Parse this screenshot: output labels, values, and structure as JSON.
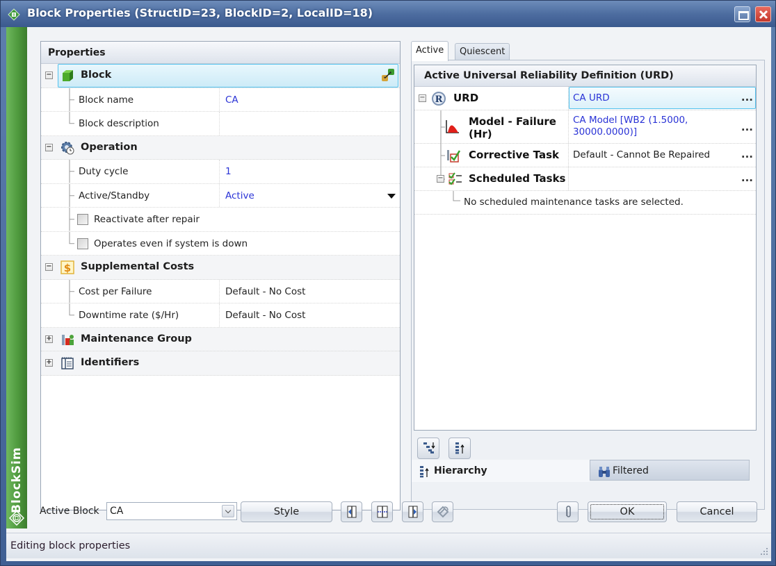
{
  "window": {
    "title": "Block Properties (StructID=23, BlockID=2, LocalID=18)",
    "brand": "BlockSim",
    "controls": [
      "maximize-icon",
      "close-icon"
    ]
  },
  "properties": {
    "header": "Properties",
    "categories": [
      {
        "label": "Block",
        "icon": "cube-icon",
        "expanded": true,
        "selected": true,
        "rows": [
          {
            "name": "Block name",
            "value": "CA",
            "style": "blue"
          },
          {
            "name": "Block description",
            "value": ""
          }
        ]
      },
      {
        "label": "Operation",
        "icon": "gear-clock-icon",
        "expanded": true,
        "rows": [
          {
            "name": "Duty cycle",
            "value": "1",
            "style": "blue"
          },
          {
            "name": "Active/Standby",
            "value": "Active",
            "style": "blue",
            "dropdown": true
          },
          {
            "checkbox": true,
            "checked": false,
            "name": "Reactivate after repair"
          },
          {
            "checkbox": true,
            "checked": false,
            "name": "Operates even if system is down"
          }
        ]
      },
      {
        "label": "Supplemental Costs",
        "icon": "dollar-icon",
        "expanded": true,
        "rows": [
          {
            "name": "Cost per Failure",
            "value": "Default - No Cost"
          },
          {
            "name": "Downtime rate ($/Hr)",
            "value": "Default - No Cost"
          }
        ]
      },
      {
        "label": "Maintenance Group",
        "icon": "maintenance-group-icon",
        "expanded": false
      },
      {
        "label": "Identifiers",
        "icon": "identifiers-icon",
        "expanded": false
      }
    ]
  },
  "urd_panel": {
    "tabs": [
      {
        "label": "Active",
        "active": true
      },
      {
        "label": "Quiescent",
        "active": false
      }
    ],
    "header": "Active Universal Reliability Definition (URD)",
    "rows": [
      {
        "name": "URD",
        "value": "CA URD",
        "icon": "urd-r-icon",
        "style": "blue",
        "selected": true
      },
      {
        "name": "Model - Failure (Hr)",
        "name_line1": "Model - Failure",
        "name_line2": "(Hr)",
        "value_line1": "CA Model [WB2 (1.5000,",
        "value_line2": "30000.0000)]",
        "icon": "failure-model-icon",
        "style": "blue"
      },
      {
        "name": "Corrective Task",
        "value": "Default - Cannot Be Repaired",
        "icon": "corrective-task-icon"
      },
      {
        "name": "Scheduled Tasks",
        "value": "",
        "icon": "scheduled-tasks-icon",
        "expanded": true
      }
    ],
    "empty_note": "No scheduled maintenance tasks are selected.",
    "ellipsis": "...",
    "toolbar": [
      "expand-all-icon",
      "collapse-all-icon"
    ],
    "bottom_tabs": [
      {
        "label": "Hierarchy",
        "icon": "hierarchy-icon",
        "active": true
      },
      {
        "label": "Filtered",
        "icon": "binoculars-icon",
        "active": false
      }
    ]
  },
  "footer": {
    "active_block_label": "Active Block",
    "active_block_value": "CA",
    "style_label": "Style",
    "nav_buttons": [
      "previous-block-icon",
      "align-icon",
      "next-block-icon",
      "refresh-icon"
    ],
    "attach_icon": "paperclip-icon",
    "ok_label": "OK",
    "cancel_label": "Cancel"
  },
  "status": {
    "text": "Editing block properties"
  },
  "colors": {
    "value_blue": "#2a33d6",
    "selection_border": "#54c2ee",
    "brand_green": "#4f9a3e",
    "title_blue": "#4d6da0"
  }
}
